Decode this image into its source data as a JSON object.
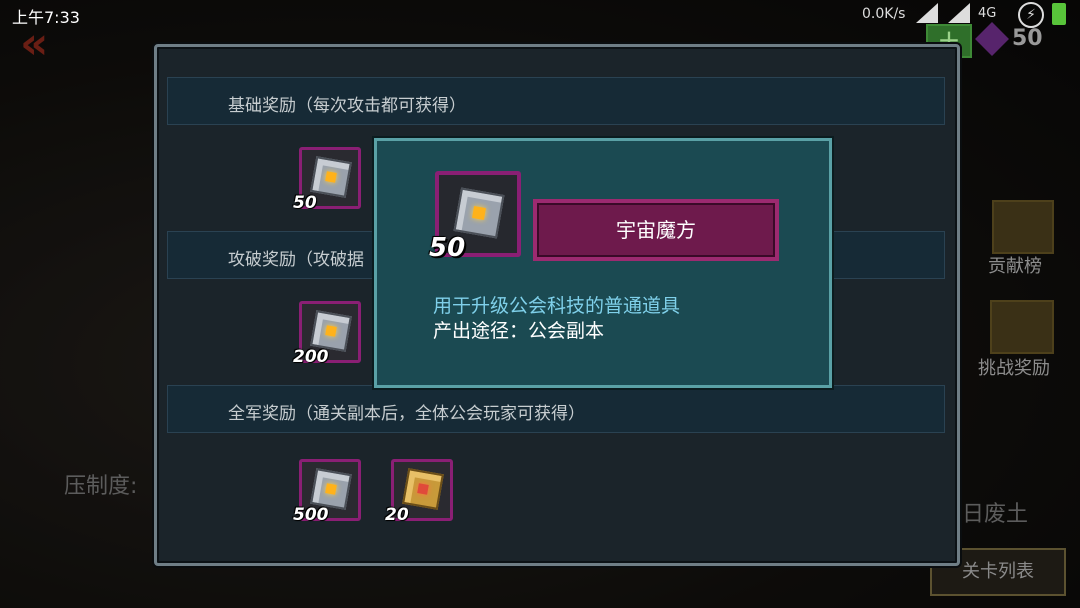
{
  "status_bar": {
    "time": "上午7:33",
    "net_speed": "0.0K/s",
    "network": "4G"
  },
  "top_right": {
    "gems": "50"
  },
  "background": {
    "leaderboard_label": "贡献榜",
    "challenge_reward_label": "挑战奖励",
    "suppression_label": "压制度:",
    "wasteland_label": "日废土",
    "stage_list_button": "关卡列表"
  },
  "panel": {
    "sections": [
      {
        "title": "基础奖励（每次攻击都可获得）",
        "rewards": [
          {
            "count": "50",
            "icon": "cosmic-cube-icon"
          }
        ]
      },
      {
        "title": "攻破奖励（攻破据",
        "rewards": [
          {
            "count": "200",
            "icon": "cosmic-cube-icon"
          }
        ]
      },
      {
        "title": "全军奖励（通关副本后，全体公会玩家可获得）",
        "rewards": [
          {
            "count": "500",
            "icon": "cosmic-cube-icon"
          },
          {
            "count": "20",
            "icon": "gold-cube-icon"
          }
        ]
      }
    ]
  },
  "popup": {
    "item_count": "50",
    "item_name": "宇宙魔方",
    "description": "用于升级公会科技的普通道具",
    "source": "产出途径：公会副本"
  },
  "colors": {
    "panel_bg": "#1b242a",
    "popup_bg": "#1b4a52",
    "item_frame": "#8a1f74",
    "name_plate": "#6e1a4c",
    "description_text": "#7fd0ea"
  }
}
